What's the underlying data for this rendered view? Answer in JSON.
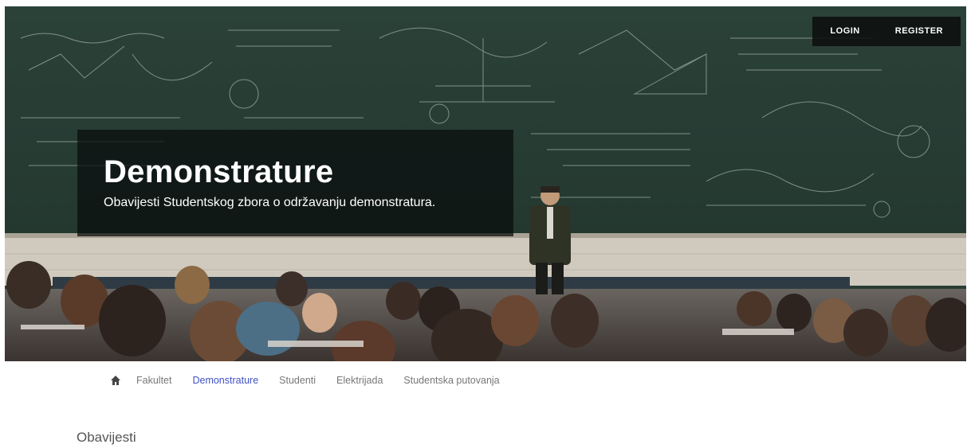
{
  "hero": {
    "title": "Demonstrature",
    "subtitle": "Obavijesti Studentskog zbora o održavanju demonstratura."
  },
  "auth": {
    "login_label": "LOGIN",
    "register_label": "REGISTER"
  },
  "nav": {
    "home_icon": "home-icon",
    "items": [
      {
        "label": "Fakultet",
        "active": false
      },
      {
        "label": "Demonstrature",
        "active": true
      },
      {
        "label": "Studenti",
        "active": false
      },
      {
        "label": "Elektrijada",
        "active": false
      },
      {
        "label": "Studentska putovanja",
        "active": false
      }
    ],
    "active_color": "#4051c4",
    "inactive_color": "#777777"
  },
  "main": {
    "section_title": "Obavijesti"
  }
}
